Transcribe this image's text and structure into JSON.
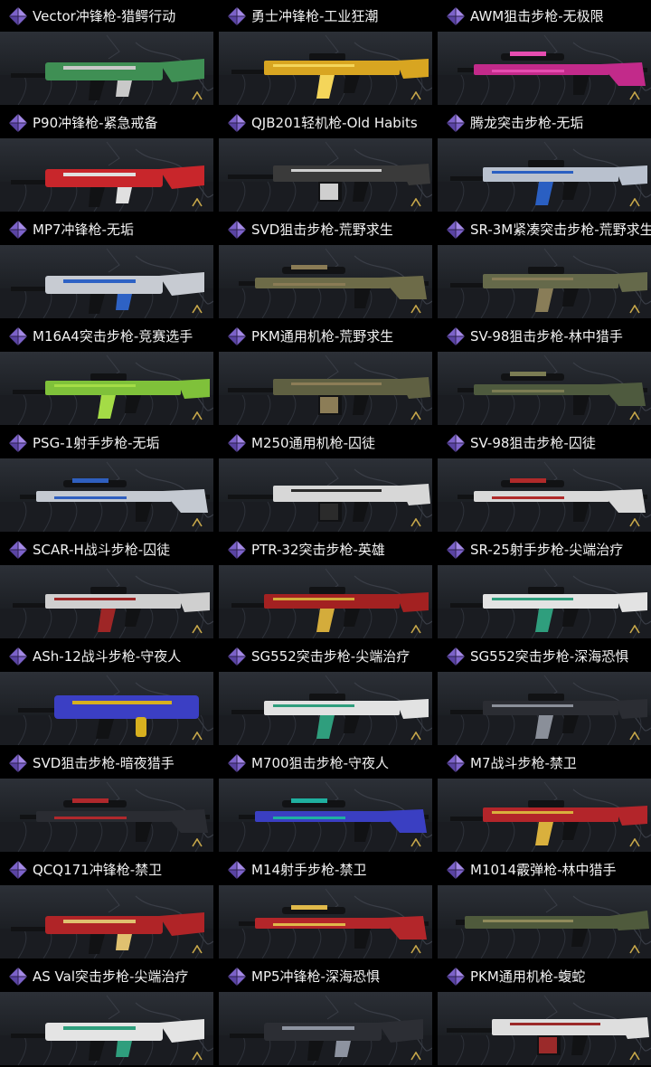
{
  "items": [
    {
      "label": "Vector冲锋枪-猎鳄行动",
      "color": "#3f8f54",
      "accent": "#c9c9c9",
      "shape": "smg"
    },
    {
      "label": "勇士冲锋枪-工业狂潮",
      "color": "#d8a521",
      "accent": "#f4d55a",
      "shape": "rifle"
    },
    {
      "label": "AWM狙击步枪-无极限",
      "color": "#c22a8a",
      "accent": "#e64cb0",
      "shape": "sniper"
    },
    {
      "label": "P90冲锋枪-紧急戒备",
      "color": "#c8262b",
      "accent": "#e0e0e0",
      "shape": "smg"
    },
    {
      "label": "QJB201轻机枪-Old Habits",
      "color": "#3a3a3a",
      "accent": "#cfcfcf",
      "shape": "lmg"
    },
    {
      "label": "腾龙突击步枪-无垢",
      "color": "#b9c1ce",
      "accent": "#2a5fc2",
      "shape": "rifle"
    },
    {
      "label": "MP7冲锋枪-无垢",
      "color": "#c7cbd2",
      "accent": "#2e62c5",
      "shape": "smg"
    },
    {
      "label": "SVD狙击步枪-荒野求生",
      "color": "#6d6b48",
      "accent": "#8a7b55",
      "shape": "sniper"
    },
    {
      "label": "SR-3M紧凑突击步枪-荒野求生",
      "color": "#65694a",
      "accent": "#897d58",
      "shape": "rifle"
    },
    {
      "label": "M16A4突击步枪-竞赛选手",
      "color": "#7fc13a",
      "accent": "#a4dc46",
      "shape": "rifle"
    },
    {
      "label": "PKM通用机枪-荒野求生",
      "color": "#5f6042",
      "accent": "#8c7d57",
      "shape": "lmg"
    },
    {
      "label": "SV-98狙击步枪-林中猎手",
      "color": "#4e5a3e",
      "accent": "#7b7c53",
      "shape": "sniper"
    },
    {
      "label": "PSG-1射手步枪-无垢",
      "color": "#c4c9d1",
      "accent": "#2f5fbf",
      "shape": "sniper"
    },
    {
      "label": "M250通用机枪-囚徒",
      "color": "#d7d7d7",
      "accent": "#2b2b2b",
      "shape": "lmg"
    },
    {
      "label": "SV-98狙击步枪-囚徒",
      "color": "#d9d9d9",
      "accent": "#b02a2a",
      "shape": "sniper"
    },
    {
      "label": "SCAR-H战斗步枪-囚徒",
      "color": "#cfcfcf",
      "accent": "#9e2626",
      "shape": "rifle"
    },
    {
      "label": "PTR-32突击步枪-英雄",
      "color": "#a32121",
      "accent": "#d4ac3b",
      "shape": "rifle"
    },
    {
      "label": "SR-25射手步枪-尖端治疗",
      "color": "#e3e3e3",
      "accent": "#2f9e7d",
      "shape": "rifle"
    },
    {
      "label": "ASh-12战斗步枪-守夜人",
      "color": "#3b3fc4",
      "accent": "#d7b01f",
      "shape": "bullpup"
    },
    {
      "label": "SG552突击步枪-尖端治疗",
      "color": "#e2e2e2",
      "accent": "#2f9e7d",
      "shape": "rifle"
    },
    {
      "label": "SG552突击步枪-深海恐惧",
      "color": "#2b2d33",
      "accent": "#8a8f99",
      "shape": "rifle"
    },
    {
      "label": "SVD狙击步枪-暗夜猎手",
      "color": "#2a2c32",
      "accent": "#b0282c",
      "shape": "sniper"
    },
    {
      "label": "M700狙击步枪-守夜人",
      "color": "#3a3fc2",
      "accent": "#1fb0a0",
      "shape": "sniper"
    },
    {
      "label": "M7战斗步枪-禁卫",
      "color": "#b3252a",
      "accent": "#d9b03d",
      "shape": "rifle"
    },
    {
      "label": "QCQ171冲锋枪-禁卫",
      "color": "#b02427",
      "accent": "#e0c170",
      "shape": "smg"
    },
    {
      "label": "M14射手步枪-禁卫",
      "color": "#b3262a",
      "accent": "#e0b94a",
      "shape": "sniper"
    },
    {
      "label": "M1014霰弹枪-林中猎手",
      "color": "#4f5a3c",
      "accent": "#8f8a5a",
      "shape": "shotgun"
    },
    {
      "label": "AS Val突击步枪-尖端治疗",
      "color": "#e4e4e4",
      "accent": "#2f9e7d",
      "shape": "smg"
    },
    {
      "label": "MP5冲锋枪-深海恐惧",
      "color": "#2c2e34",
      "accent": "#8d93a0",
      "shape": "smg"
    },
    {
      "label": "PKM通用机枪-蝮蛇",
      "color": "#dedede",
      "accent": "#9b2a2a",
      "shape": "lmg"
    }
  ]
}
